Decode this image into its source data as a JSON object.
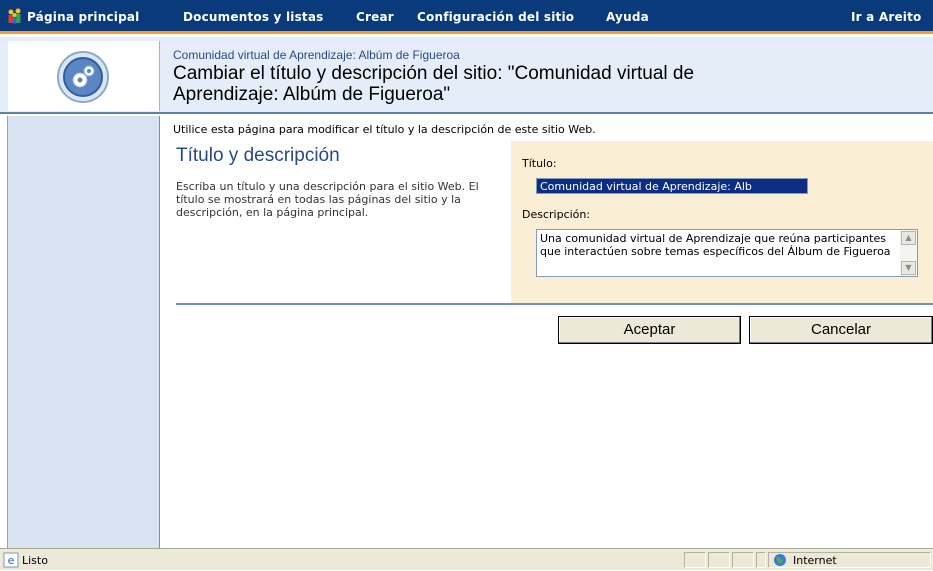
{
  "nav": {
    "items": [
      "Página principal",
      "Documentos y listas",
      "Crear",
      "Configuración del sitio",
      "Ayuda"
    ],
    "right_link": "Ir a Areito"
  },
  "header": {
    "breadcrumb": "Comunidad virtual de Aprendizaje: Albúm de Figueroa",
    "title_line1": "Cambiar el título y descripción del sitio: \"Comunidad virtual de",
    "title_line2": "Aprendizaje: Albúm de Figueroa\""
  },
  "intro": "Utilice esta página para modificar el título y la descripción de este sitio Web.",
  "section": {
    "title": "Título y descripción",
    "description": "Escriba un título y una descripción para el sitio Web. El título se mostrará en todas las páginas del sitio y la descripción, en la página principal."
  },
  "form": {
    "title_label": "Título:",
    "title_value": "Comunidad virtual de Aprendizaje: Alb",
    "description_label": "Descripción:",
    "description_value": "Una comunidad virtual de Aprendizaje que reúna participantes que interactúen sobre temas específicos del Álbum de Figueroa"
  },
  "buttons": {
    "ok": "Aceptar",
    "cancel": "Cancelar"
  },
  "status": {
    "text": "Listo",
    "zone": "Internet"
  },
  "colors": {
    "topbar": "#083a7c",
    "accent": "#ff9a1e",
    "header_bg": "#e5eef8",
    "form_bg": "#faeed4"
  },
  "icons": [
    "people-icon",
    "site-settings-logo-icon",
    "ie-page-icon",
    "globe-icon",
    "scroll-up-icon",
    "scroll-down-icon"
  ]
}
